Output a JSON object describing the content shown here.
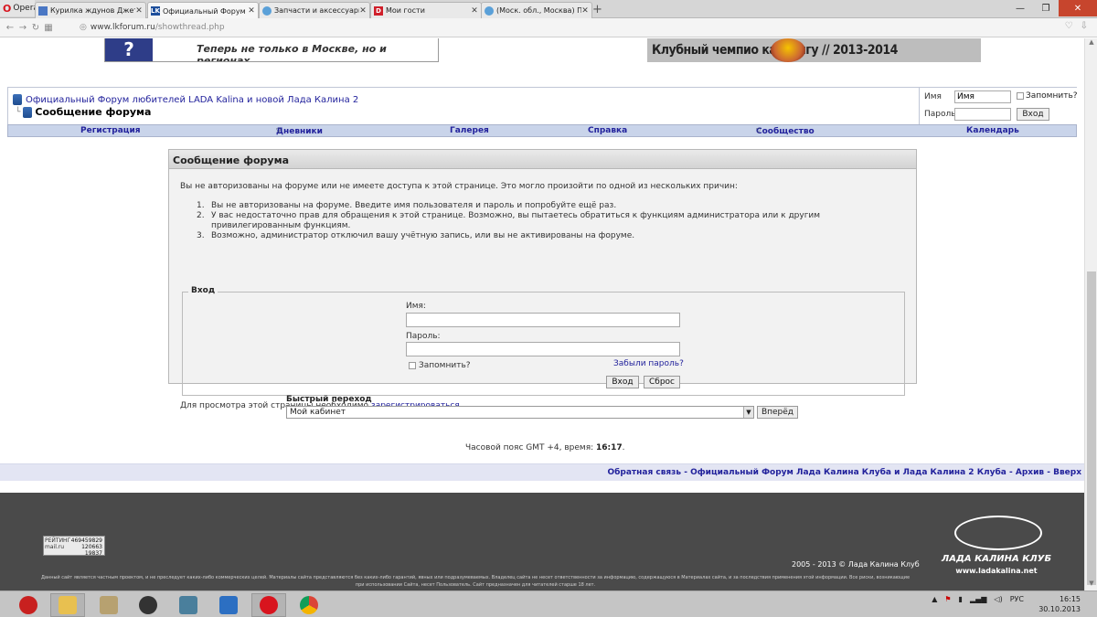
{
  "browser": {
    "menu_label": "Opera",
    "tabs": [
      {
        "title": "Курилка ждунов Джетты",
        "favicon": "forum-favicon",
        "color": "#4a77c4"
      },
      {
        "title": "Официальный Форум ле",
        "favicon": "lk-favicon",
        "color": "#1e4f9c"
      },
      {
        "title": "Запчасти и аксессуары",
        "favicon": "globe-favicon",
        "color": "#5aa0d8"
      },
      {
        "title": "Мои гости",
        "favicon": "d-favicon",
        "color": "#d01f2a"
      },
      {
        "title": "(Моск. обл., Москва) Пр",
        "favicon": "globe-favicon",
        "color": "#5aa0d8"
      }
    ],
    "url_host": "www.lkforum.ru",
    "url_path": "/showthread.php"
  },
  "banners": {
    "left_text": "Теперь не только в Москве, но и регионах.",
    "right_text": "Клубный чемпио     картингу // 2013-2014"
  },
  "header": {
    "breadcrumb_root": "Официальный Форум любителей LADA Kalina и новой Лада Калина 2",
    "page_title": "Сообщение форума",
    "login": {
      "name_label": "Имя",
      "name_value": "Имя",
      "remember_label": "Запомнить?",
      "password_label": "Пароль",
      "submit_label": "Вход"
    }
  },
  "nav": [
    "Регистрация",
    "Дневники",
    "Галерея",
    "Справка",
    "Сообщество",
    "Календарь"
  ],
  "message": {
    "title": "Сообщение форума",
    "intro": "Вы не авторизованы на форуме или не имеете доступа к этой странице. Это могло произойти по одной из нескольких причин:",
    "reasons": [
      {
        "num": "1.",
        "text": "Вы не авторизованы на форуме. Введите имя пользователя и пароль и попробуйте ещё раз."
      },
      {
        "num": "2.",
        "text": "У вас недостаточно прав для обращения к этой странице. Возможно, вы пытаетесь обратиться к функциям администратора или к другим привилегированным функциям."
      },
      {
        "num": "3.",
        "text": "Возможно, администратор отключил вашу учётную запись, или вы не активированы на форуме."
      }
    ],
    "login_legend": "Вход",
    "name_label": "Имя:",
    "password_label": "Пароль:",
    "remember_label": "Запомнить?",
    "forgot_label": "Забыли пароль?",
    "submit_label": "Вход",
    "reset_label": "Сброс",
    "register_prefix": "Для просмотра этой страницы необходимо ",
    "register_link": "зарегистрироваться",
    "register_suffix": "."
  },
  "quick_nav": {
    "label": "Быстрый переход",
    "selected": "Мой кабинет",
    "go_label": "Вперёд"
  },
  "timezone": {
    "prefix": "Часовой пояс GMT +4, время: ",
    "time": "16:17",
    "suffix": "."
  },
  "footer": {
    "links": "Обратная связь - Официальный Форум Лада Калина Клуба и Лада Калина 2 Клуба - Архив - Вверх",
    "counter_left": "РЕЙТИНГ\nmail.ru",
    "counter_right": "469459829\n120663\n19837",
    "copyright": "2005 - 2013 © Лада Калина Клуб",
    "disclaimer": "Данный сайт является частным проектом, и не преследует каких-либо коммерческих целей. Материалы сайта представляются без каких-либо гарантий, явных или подразумеваемых. Владелец сайта не несет ответственности за информацию, содержащуюся в Материалах сайта, и за последствия применения этой информации. Все риски, возникающие при использовании Сайта, несет Пользователь. Сайт предназначен для читателей старше 18 лет.",
    "logo_text": "ЛАДА КАЛИНА КЛУБ",
    "logo_url": "www.ladakalina.net"
  },
  "taskbar": {
    "lang": "РУС",
    "time": "16:15",
    "date": "30.10.2013"
  }
}
